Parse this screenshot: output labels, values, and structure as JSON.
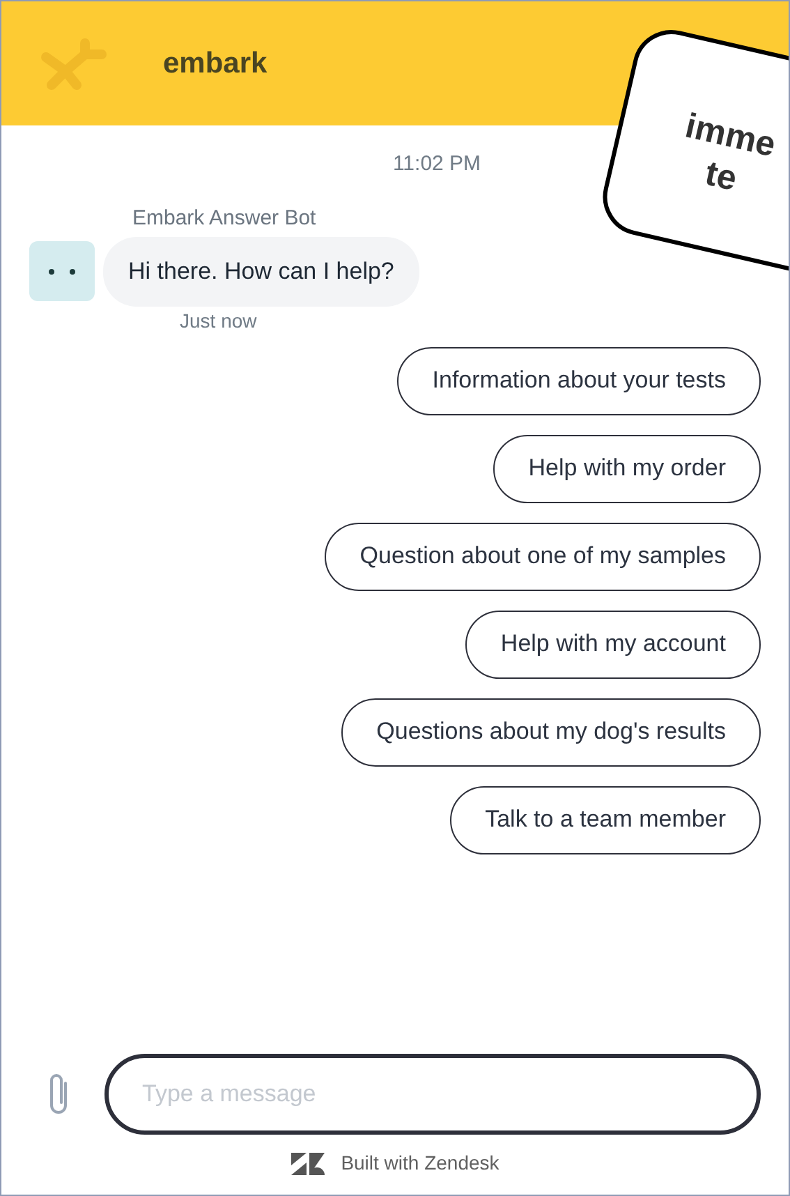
{
  "header": {
    "title": "embark"
  },
  "callout": {
    "lines": [
      "imme",
      "te"
    ]
  },
  "conversation": {
    "timestamp": "11:02 PM",
    "sender": "Embark Answer Bot",
    "message": "Hi there. How can I help?",
    "message_time": "Just now"
  },
  "quick_replies": [
    "Information about your tests",
    "Help with my order",
    "Question about one of my samples",
    "Help with my account",
    "Questions about my dog's results",
    "Talk to a team member"
  ],
  "composer": {
    "placeholder": "Type a message"
  },
  "footer": {
    "text": "Built with Zendesk"
  }
}
